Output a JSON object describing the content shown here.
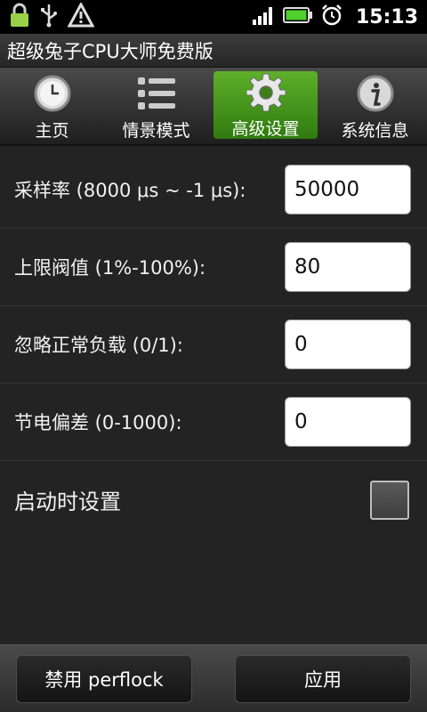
{
  "status_bar": {
    "time": "15:13",
    "icons": [
      "lock-icon",
      "usb-icon",
      "warning-icon",
      "signal-icon",
      "battery-icon",
      "alarm-icon"
    ]
  },
  "title_bar": {
    "title": "超级兔子CPU大师免费版"
  },
  "tabs": [
    {
      "label": "主页",
      "icon": "clock-icon",
      "active": false
    },
    {
      "label": "情景模式",
      "icon": "list-icon",
      "active": false
    },
    {
      "label": "高级设置",
      "icon": "gear-icon",
      "active": true
    },
    {
      "label": "系统信息",
      "icon": "info-icon",
      "active": false
    }
  ],
  "settings": [
    {
      "label": "采样率 (8000 μs ~ -1 μs):",
      "value": "50000"
    },
    {
      "label": "上限阀值 (1%-100%):",
      "value": "80"
    },
    {
      "label": "忽略正常负载 (0/1):",
      "value": "0"
    },
    {
      "label": "节电偏差 (0-1000):",
      "value": "0"
    }
  ],
  "startup": {
    "label": "启动时设置",
    "checked": false
  },
  "bottom": {
    "disable_label": "禁用 perflock",
    "apply_label": "应用"
  },
  "colors": {
    "accent": "#4a9a1e",
    "background": "#232323"
  }
}
